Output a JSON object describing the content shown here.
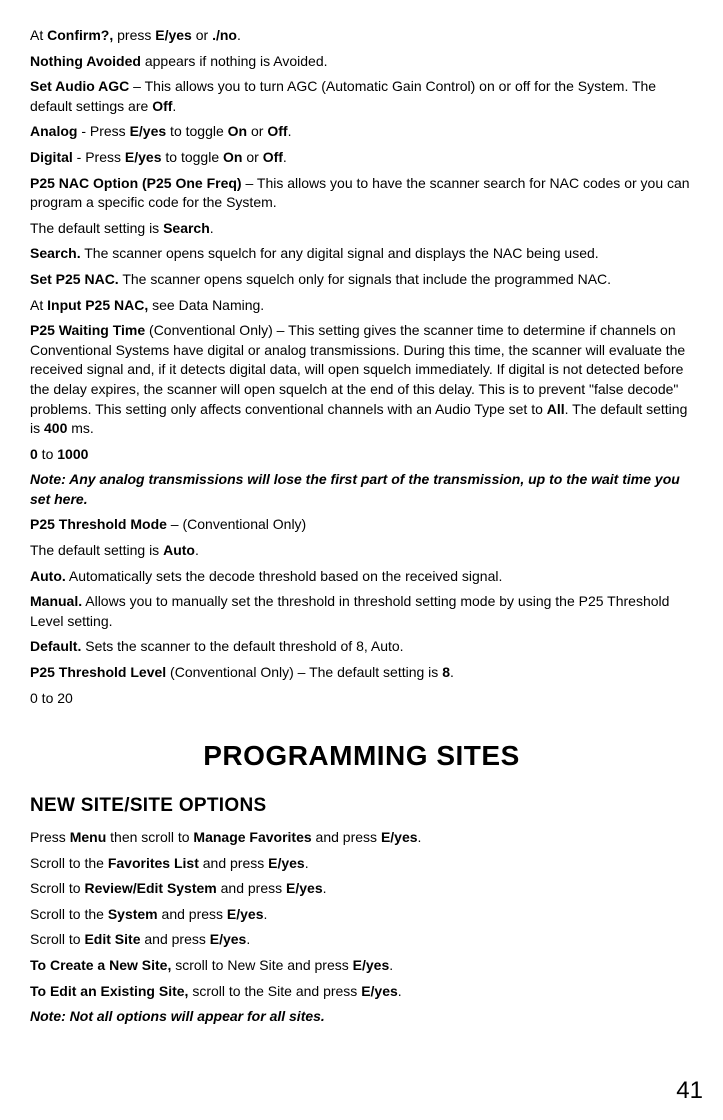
{
  "top": {
    "confirm_line": {
      "pre": "At ",
      "confirm": "Confirm?,",
      "mid": " press ",
      "eyes": "E/yes",
      "or": " or ",
      "no": "./no",
      "end": "."
    },
    "nothing_avoided": {
      "b": "Nothing Avoided",
      "rest": " appears if nothing is Avoided."
    }
  },
  "audio_agc": {
    "title": "Set Audio AGC",
    "desc": " – This allows you to turn AGC (Automatic Gain Control) on or off for the System. The default settings are ",
    "off": "Off",
    "end": ".",
    "analog": {
      "label": "Analog",
      "mid": " - Press ",
      "eyes": "E/yes",
      "mid2": " to toggle ",
      "on": "On",
      "or": " or ",
      "off": "Off",
      "end": "."
    },
    "digital": {
      "label": "Digital",
      "mid": " - Press ",
      "eyes": "E/yes",
      "mid2": " to toggle ",
      "on": "On",
      "or": " or ",
      "off": "Off",
      "end": "."
    }
  },
  "nac": {
    "title": "P25 NAC Option (P25 One Freq)",
    "desc": " – This allows you to have the scanner search for NAC codes or you can program a specific code for the System.",
    "default_pre": "The default setting is ",
    "default_val": "Search",
    "default_end": ".",
    "search": {
      "b": "Search.",
      "rest": " The scanner opens squelch for any digital signal and displays the NAC being used."
    },
    "setp25": {
      "b": "Set P25 NAC.",
      "rest": " The scanner opens squelch only for signals that include the programmed NAC."
    },
    "input": {
      "pre": "At ",
      "b": "Input P25 NAC,",
      "rest": " see Data Naming."
    }
  },
  "waittime": {
    "title": "P25 Waiting Time",
    "desc1": " (Conventional Only) – This setting gives the scanner time to determine if channels on Conventional Systems have digital or analog transmissions. During this time, the scanner will evaluate the received signal and, if it detects digital data, will open squelch immediately. If digital is not detected before the delay expires, the scanner will open squelch at the end of this delay. This is to prevent \"false decode\" problems. This setting only affects conventional channels with an Audio Type set to ",
    "all": "All",
    "desc2": ". The default setting is ",
    "val": "400",
    "desc3": " ms.",
    "range": {
      "b1": "0",
      "mid": " to ",
      "b2": "1000"
    },
    "note": "Note: Any analog transmissions will lose the first part of the transmission, up to the wait time you set here."
  },
  "thresh_mode": {
    "title": "P25 Threshold Mode",
    "desc": " – (Conventional Only)",
    "default_pre": "The default setting is ",
    "default_val": "Auto",
    "default_end": ".",
    "auto": {
      "b": "Auto.",
      "rest": " Automatically sets the decode threshold based on the received signal."
    },
    "manual": {
      "b": "Manual.",
      "rest": " Allows you to manually set the threshold in threshold setting mode by using the P25 Threshold Level setting."
    },
    "default_opt": {
      "b": "Default.",
      "rest": " Sets the scanner to the default threshold of 8, Auto."
    }
  },
  "thresh_level": {
    "title": "P25 Threshold Level",
    "desc": " (Conventional Only) – The default setting is ",
    "val": "8",
    "end": ".",
    "range": "0 to 20"
  },
  "section_title": "PROGRAMMING SITES",
  "subsection": "NEW SITE/SITE OPTIONS",
  "steps": {
    "s1": {
      "pre": "Press ",
      "b1": "Menu",
      "mid": " then scroll to ",
      "b2": "Manage Favorites",
      "mid2": " and press ",
      "b3": "E/yes",
      "end": "."
    },
    "s2": {
      "pre": "Scroll to the ",
      "b1": "Favorites List",
      "mid": " and press ",
      "b2": "E/yes",
      "end": "."
    },
    "s3": {
      "pre": "Scroll to ",
      "b1": "Review/Edit System",
      "mid": " and press ",
      "b2": "E/yes",
      "end": "."
    },
    "s4": {
      "pre": "Scroll to the ",
      "b1": "System",
      "mid": " and press ",
      "b2": "E/yes",
      "end": "."
    },
    "s5": {
      "pre": "Scroll to ",
      "b1": "Edit Site",
      "mid": " and press ",
      "b2": "E/yes",
      "end": "."
    },
    "create": {
      "b1": "To Create a New Site,",
      "mid": " scroll to New Site and press ",
      "b2": "E/yes",
      "end": "."
    },
    "edit": {
      "b1": "To Edit an Existing Site,",
      "mid": " scroll to the Site and press ",
      "b2": "E/yes",
      "end": "."
    }
  },
  "final_note": "Note: Not all options will appear for all sites.",
  "page_number": "41"
}
